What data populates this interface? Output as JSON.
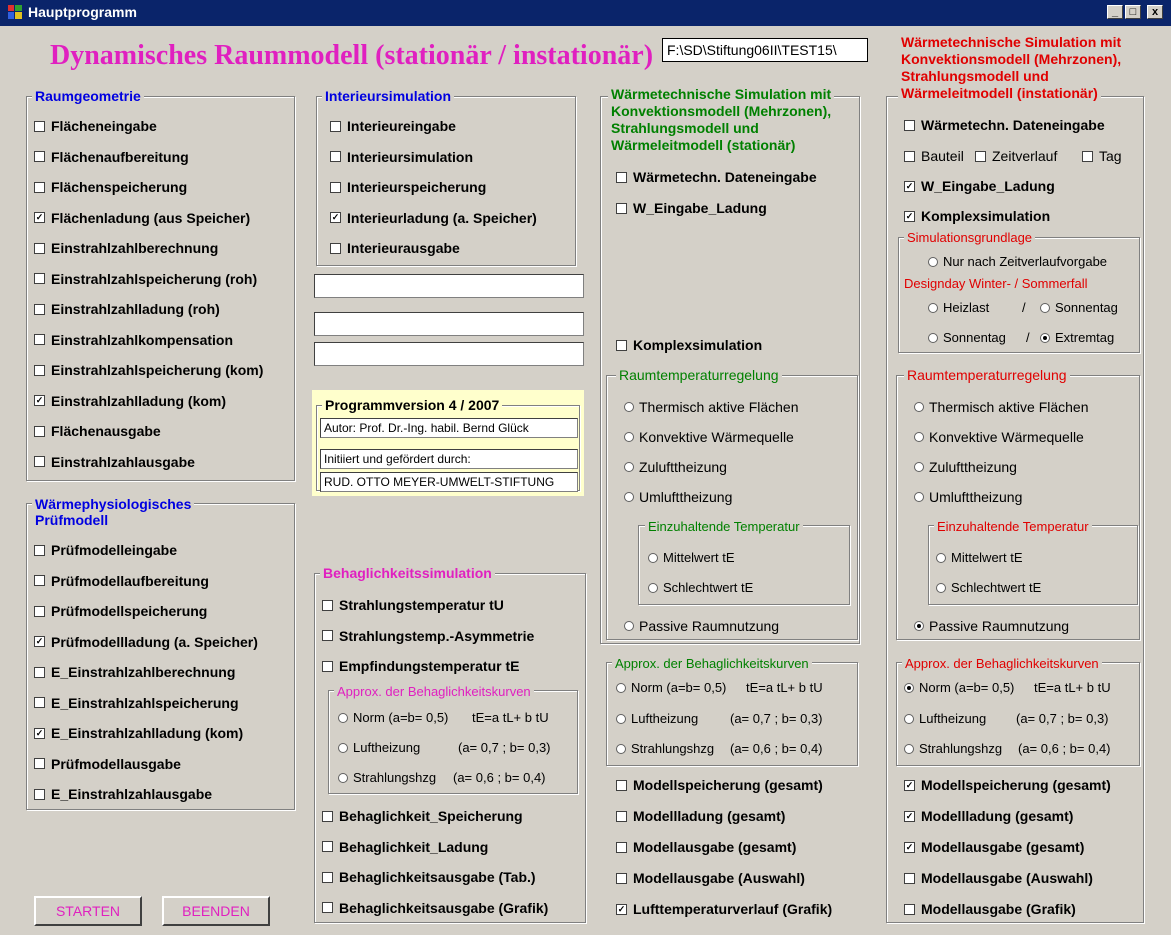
{
  "window": {
    "title": "Hauptprogramm",
    "minimize": "_",
    "maximize": "□",
    "close": "x"
  },
  "header": {
    "title": "Dynamisches Raummodell (stationär / instationär)",
    "path": "F:\\SD\\Stiftung06II\\TEST15\\"
  },
  "raumgeometrie": {
    "title": "Raumgeometrie",
    "items": [
      {
        "label": "Flächeneingabe",
        "mark": ""
      },
      {
        "label": "Flächenaufbereitung",
        "mark": ""
      },
      {
        "label": "Flächenspeicherung",
        "mark": ""
      },
      {
        "label": "Flächenladung (aus Speicher)",
        "mark": "✓"
      },
      {
        "label": "Einstrahlzahlberechnung",
        "mark": ""
      },
      {
        "label": "Einstrahlzahlspeicherung (roh)",
        "mark": ""
      },
      {
        "label": "Einstrahlzahlladung (roh)",
        "mark": ""
      },
      {
        "label": "Einstrahlzahlkompensation",
        "mark": ""
      },
      {
        "label": "Einstrahlzahlspeicherung (kom)",
        "mark": ""
      },
      {
        "label": "Einstrahlzahlladung (kom)",
        "mark": "✓"
      },
      {
        "label": "Flächenausgabe",
        "mark": ""
      },
      {
        "label": "Einstrahlzahlausgabe",
        "mark": ""
      }
    ]
  },
  "waermephysio": {
    "title1": "Wärmephysiologisches",
    "title2": "Prüfmodell",
    "items": [
      {
        "label": "Prüfmodelleingabe",
        "mark": ""
      },
      {
        "label": "Prüfmodellaufbereitung",
        "mark": ""
      },
      {
        "label": "Prüfmodellspeicherung",
        "mark": ""
      },
      {
        "label": "Prüfmodellladung (a. Speicher)",
        "mark": "✓"
      },
      {
        "label": "E_Einstrahlzahlberechnung",
        "mark": ""
      },
      {
        "label": "E_Einstrahlzahlspeicherung",
        "mark": ""
      },
      {
        "label": "E_Einstrahlzahlladung (kom)",
        "mark": "✓"
      },
      {
        "label": "Prüfmodellausgabe",
        "mark": ""
      },
      {
        "label": "E_Einstrahlzahlausgabe",
        "mark": ""
      }
    ]
  },
  "interieur": {
    "title": "Interieursimulation",
    "items": [
      {
        "label": "Interieureingabe",
        "mark": ""
      },
      {
        "label": "Interieursimulation",
        "mark": ""
      },
      {
        "label": "Interieurspeicherung",
        "mark": ""
      },
      {
        "label": "Interieurladung (a. Speicher)",
        "mark": "✓"
      },
      {
        "label": "Interieurausgabe",
        "mark": ""
      }
    ]
  },
  "textboxes": [
    "",
    "",
    ""
  ],
  "version": {
    "title": "Programmversion 4 / 2007",
    "author": "Autor: Prof. Dr.-Ing. habil. Bernd Glück",
    "initiated": "Initiiert und gefördert durch:",
    "sponsor": "RUD. OTTO MEYER-UMWELT-STIFTUNG"
  },
  "behaglichkeit": {
    "title": "Behaglichkeitssimulation",
    "top": [
      {
        "label": "Strahlungstemperatur tU",
        "mark": ""
      },
      {
        "label": "Strahlungstemp.-Asymmetrie",
        "mark": ""
      },
      {
        "label": "Empfindungstemperatur tE",
        "mark": ""
      }
    ],
    "approx": {
      "title": "Approx. der Behaglichkeitskurven",
      "r1a": "Norm  (a=b= 0,5)",
      "r1b": "tE=a tL+ b tU",
      "r2a": "Luftheizung",
      "r2b": "(a= 0,7 ;  b= 0,3)",
      "r3a": "Strahlungshzg",
      "r3b": "(a= 0,6 ; b= 0,4)"
    },
    "bottom": [
      {
        "label": "Behaglichkeit_Speicherung",
        "mark": ""
      },
      {
        "label": "Behaglichkeit_Ladung",
        "mark": ""
      },
      {
        "label": "Behaglichkeitsausgabe (Tab.)",
        "mark": ""
      },
      {
        "label": "Behaglichkeitsausgabe (Grafik)",
        "mark": ""
      }
    ]
  },
  "stationaer": {
    "title1": "Wärmetechnische Simulation mit",
    "title2": "Konvektionsmodell (Mehrzonen),",
    "title3": "Strahlungsmodell und",
    "title4": "Wärmeleitmodell (stationär)",
    "dateneingabe": {
      "label": "Wärmetechn.  Dateneingabe",
      "mark": ""
    },
    "eingabe_ladung": {
      "label": "W_Eingabe_Ladung",
      "mark": ""
    },
    "komplex": {
      "label": "Komplexsimulation",
      "mark": ""
    },
    "regelung": {
      "title": "Raumtemperaturregelung",
      "opts": [
        "Thermisch aktive Flächen",
        "Konvektive Wärmequelle",
        "Zulufttheizung",
        "Umlufttheizung"
      ],
      "einzu": "Einzuhaltende Temperatur",
      "mittel": "Mittelwert tE",
      "schlecht": "Schlechtwert tE",
      "passiv": "Passive Raumnutzung"
    },
    "approx": {
      "title": "Approx. der Behaglichkeitskurven",
      "r1a": "Norm  (a=b= 0,5)",
      "r1b": "tE=a tL+ b tU",
      "r2a": "Luftheizung",
      "r2b": "(a= 0,7 ;  b= 0,3)",
      "r3a": "Strahlungshzg",
      "r3b": "(a= 0,6 ; b= 0,4)"
    },
    "bottom": [
      {
        "label": "Modellspeicherung (gesamt)",
        "mark": ""
      },
      {
        "label": "Modellladung (gesamt)",
        "mark": ""
      },
      {
        "label": "Modellausgabe (gesamt)",
        "mark": ""
      },
      {
        "label": "Modellausgabe (Auswahl)",
        "mark": ""
      },
      {
        "label": "Lufttemperaturverlauf (Grafik)",
        "mark": "✓"
      }
    ]
  },
  "instationaer": {
    "title1": "Wärmetechnische Simulation mit",
    "title2": "Konvektionsmodell (Mehrzonen),",
    "title3": "Strahlungsmodell und",
    "title4": "Wärmeleitmodell (instationär)",
    "dateneingabe": {
      "label": "Wärmetechn.  Dateneingabe",
      "mark": ""
    },
    "bauteil": {
      "label": "Bauteil",
      "mark": ""
    },
    "zeitverlauf": {
      "label": "Zeitverlauf",
      "mark": ""
    },
    "tag": {
      "label": "Tag",
      "mark": ""
    },
    "eingabe_ladung": {
      "label": "W_Eingabe_Ladung",
      "mark": "✓"
    },
    "komplex": {
      "label": "Komplexsimulation",
      "mark": "✓"
    },
    "grundlage": {
      "title": "Simulationsgrundlage",
      "nur": "Nur nach Zeitverlaufvorgabe",
      "designday": "Designday Winter- / Sommerfall",
      "heizlast": "Heizlast",
      "slash": "/",
      "sonnentag1": "Sonnentag",
      "sonnentag2": "Sonnentag",
      "slash2": "/",
      "extremtag": "Extremtag"
    },
    "regelung": {
      "title": "Raumtemperaturregelung",
      "opts": [
        "Thermisch aktive Flächen",
        "Konvektive Wärmequelle",
        "Zulufttheizung",
        "Umlufttheizung"
      ],
      "einzu": "Einzuhaltende Temperatur",
      "mittel": "Mittelwert tE",
      "schlecht": "Schlechtwert tE",
      "passiv": "Passive Raumnutzung"
    },
    "approx": {
      "title": "Approx. der Behaglichkeitskurven",
      "r1a": "Norm  (a=b= 0,5)",
      "r1b": "tE=a tL+ b tU",
      "r2a": "Luftheizung",
      "r2b": "(a= 0,7 ;  b= 0,3)",
      "r3a": "Strahlungshzg",
      "r3b": "(a= 0,6 ; b= 0,4)"
    },
    "bottom": [
      {
        "label": "Modellspeicherung (gesamt)",
        "mark": "✓"
      },
      {
        "label": "Modellladung (gesamt)",
        "mark": "✓"
      },
      {
        "label": "Modellausgabe (gesamt)",
        "mark": "✓"
      },
      {
        "label": "Modellausgabe (Auswahl)",
        "mark": ""
      },
      {
        "label": "Modellausgabe (Grafik)",
        "mark": ""
      }
    ]
  },
  "buttons": {
    "start": "STARTEN",
    "stop": "BEENDEN"
  }
}
